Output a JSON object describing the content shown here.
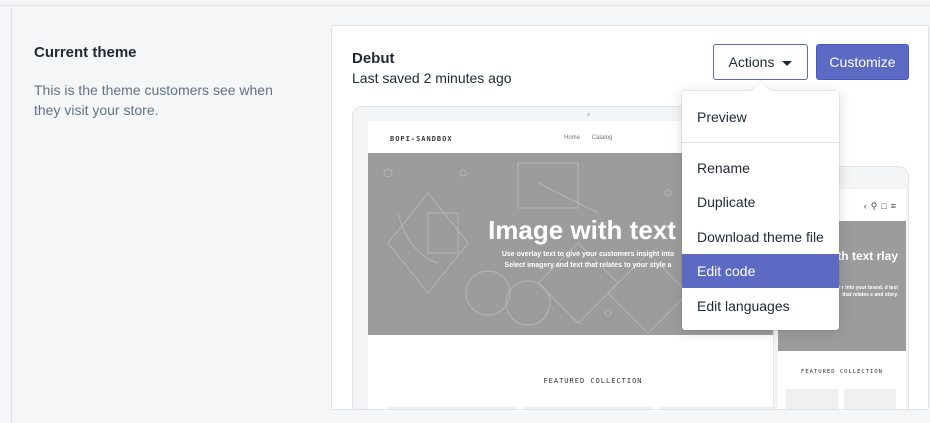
{
  "current_theme": {
    "title": "Current theme",
    "description": "This is the theme customers see when they visit your store."
  },
  "theme": {
    "name": "Debut",
    "last_saved": "Last saved 2 minutes ago"
  },
  "buttons": {
    "actions": "Actions",
    "customize": "Customize"
  },
  "actions_menu": {
    "preview": "Preview",
    "items": [
      "Rename",
      "Duplicate",
      "Download theme file",
      "Edit code",
      "Edit languages"
    ],
    "highlighted": "Edit code"
  },
  "preview": {
    "store_name": "BOPI-SANDBOX",
    "nav": [
      "Home",
      "Catalog"
    ],
    "hero_title": "Image with text ove",
    "hero_sub_line1": "Use overlay text to give your customers insight into",
    "hero_sub_line2": "Select imagery and text that relates to your style a",
    "featured": "FEATURED COLLECTION",
    "mobile_hero_title": "vith text rlay",
    "mobile_hero_sub": "xt to give your r into your brand. d text that relates e and story.",
    "mobile_featured": "FEATURED COLLECTION"
  },
  "colors": {
    "accent": "#5c6ac4",
    "background": "#f4f6f8",
    "hero_gray": "#9c9c9c"
  },
  "icons": [
    "chevron-down-icon",
    "search-icon",
    "bag-icon",
    "menu-icon"
  ]
}
